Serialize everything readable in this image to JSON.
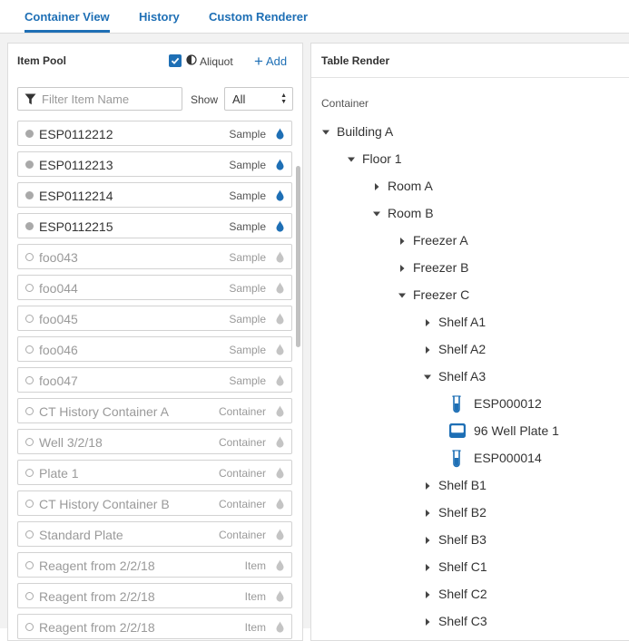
{
  "tabs": [
    {
      "label": "Container View",
      "active": true
    },
    {
      "label": "History",
      "active": false
    },
    {
      "label": "Custom Renderer",
      "active": false
    }
  ],
  "pool": {
    "title": "Item Pool",
    "aliquot_label": "Aliquot",
    "aliquot_checked": true,
    "add_label": "Add",
    "filter_placeholder": "Filter Item Name",
    "show_label": "Show",
    "show_value": "All",
    "items": [
      {
        "name": "ESP0112212",
        "type": "Sample",
        "status": "active"
      },
      {
        "name": "ESP0112213",
        "type": "Sample",
        "status": "active"
      },
      {
        "name": "ESP0112214",
        "type": "Sample",
        "status": "active"
      },
      {
        "name": "ESP0112215",
        "type": "Sample",
        "status": "active"
      },
      {
        "name": "foo043",
        "type": "Sample",
        "status": "muted"
      },
      {
        "name": "foo044",
        "type": "Sample",
        "status": "muted"
      },
      {
        "name": "foo045",
        "type": "Sample",
        "status": "muted"
      },
      {
        "name": "foo046",
        "type": "Sample",
        "status": "muted"
      },
      {
        "name": "foo047",
        "type": "Sample",
        "status": "muted"
      },
      {
        "name": "CT History Container A",
        "type": "Container",
        "status": "muted"
      },
      {
        "name": "Well 3/2/18",
        "type": "Container",
        "status": "muted"
      },
      {
        "name": "Plate 1",
        "type": "Container",
        "status": "muted"
      },
      {
        "name": "CT History Container B",
        "type": "Container",
        "status": "muted"
      },
      {
        "name": "Standard Plate",
        "type": "Container",
        "status": "muted"
      },
      {
        "name": "Reagent from 2/2/18",
        "type": "Item",
        "status": "muted"
      },
      {
        "name": "Reagent from 2/2/18",
        "type": "Item",
        "status": "muted"
      },
      {
        "name": "Reagent from 2/2/18",
        "type": "Item",
        "status": "muted"
      }
    ]
  },
  "render": {
    "title": "Table Render",
    "column_label": "Container",
    "tree": [
      {
        "label": "Building A",
        "level": 0,
        "state": "open"
      },
      {
        "label": "Floor 1",
        "level": 1,
        "state": "open"
      },
      {
        "label": "Room A",
        "level": 2,
        "state": "closed"
      },
      {
        "label": "Room B",
        "level": 2,
        "state": "open"
      },
      {
        "label": "Freezer A",
        "level": 3,
        "state": "closed"
      },
      {
        "label": "Freezer B",
        "level": 3,
        "state": "closed"
      },
      {
        "label": "Freezer C",
        "level": 3,
        "state": "open"
      },
      {
        "label": "Shelf A1",
        "level": 4,
        "state": "closed"
      },
      {
        "label": "Shelf A2",
        "level": 4,
        "state": "closed"
      },
      {
        "label": "Shelf A3",
        "level": 4,
        "state": "open"
      },
      {
        "label": "ESP000012",
        "level": 5,
        "state": "leaf",
        "icon": "tube-icon"
      },
      {
        "label": "96 Well Plate 1",
        "level": 5,
        "state": "leaf",
        "icon": "plate-icon"
      },
      {
        "label": "ESP000014",
        "level": 5,
        "state": "leaf",
        "icon": "tube-icon"
      },
      {
        "label": "Shelf B1",
        "level": 4,
        "state": "closed"
      },
      {
        "label": "Shelf B2",
        "level": 4,
        "state": "closed"
      },
      {
        "label": "Shelf B3",
        "level": 4,
        "state": "closed"
      },
      {
        "label": "Shelf C1",
        "level": 4,
        "state": "closed"
      },
      {
        "label": "Shelf C2",
        "level": 4,
        "state": "closed"
      },
      {
        "label": "Shelf C3",
        "level": 4,
        "state": "closed"
      }
    ]
  },
  "colors": {
    "accent": "#1e6fb5",
    "muted_text": "#9a9a9a",
    "drop_active": "#1e6fb5",
    "drop_muted": "#c4c4c4"
  }
}
